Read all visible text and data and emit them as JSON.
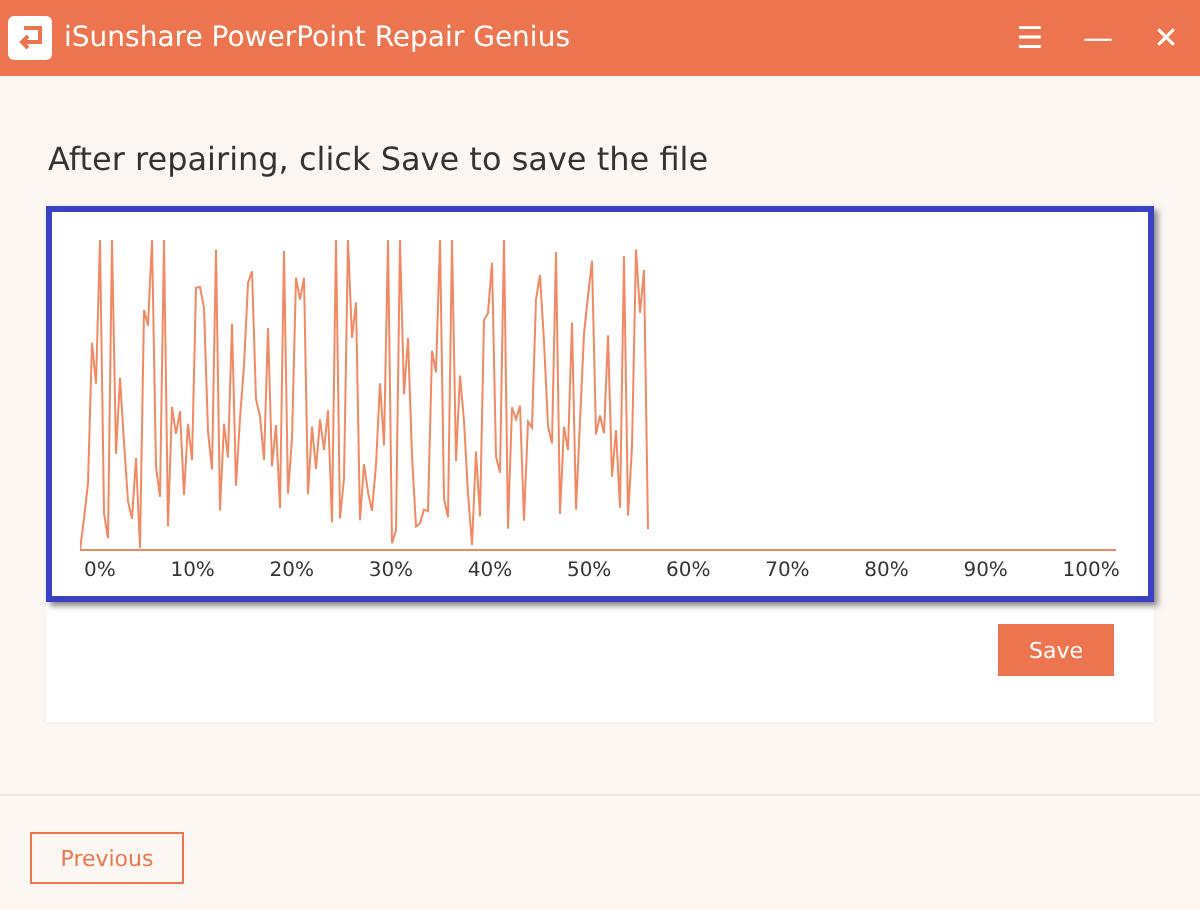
{
  "window": {
    "title": "iSunshare PowerPoint Repair Genius",
    "controls": [
      "☰",
      "—",
      "✕"
    ]
  },
  "heading": "After repairing, click Save to save the file",
  "waveform": {
    "level": 0.55,
    "axis_labels": [
      "0%",
      "10%",
      "20%",
      "30%",
      "40%",
      "50%",
      "60%",
      "70%",
      "80%",
      "90%",
      "100%"
    ]
  },
  "save_button": "Save",
  "previous_button": "Previous"
}
